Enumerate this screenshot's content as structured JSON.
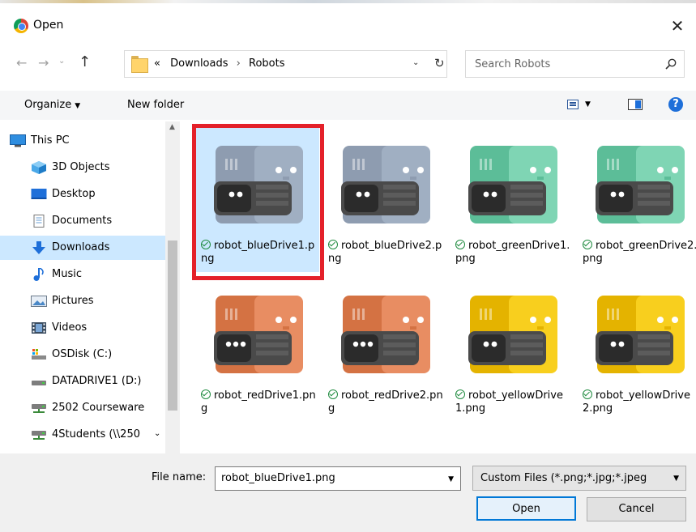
{
  "window": {
    "title": "Open",
    "close_symbol": "✕"
  },
  "nav": {
    "back": "←",
    "forward": "→",
    "history": "⌄",
    "up": "↑",
    "breadcrumbs": [
      "Downloads",
      "Robots"
    ],
    "breadcrumb_prefix": "«",
    "breadcrumb_sep": "›",
    "address_dropdown": "⌄",
    "refresh": "↻",
    "search_placeholder": "Search Robots"
  },
  "toolbar": {
    "organize": "Organize",
    "new_folder": "New folder",
    "help": "?"
  },
  "sidebar": {
    "items": [
      {
        "label": "This PC",
        "icon": "pc-icon"
      },
      {
        "label": "3D Objects",
        "icon": "3d-objects-icon"
      },
      {
        "label": "Desktop",
        "icon": "desktop-icon"
      },
      {
        "label": "Documents",
        "icon": "documents-icon"
      },
      {
        "label": "Downloads",
        "icon": "downloads-icon",
        "selected": true
      },
      {
        "label": "Music",
        "icon": "music-icon"
      },
      {
        "label": "Pictures",
        "icon": "pictures-icon"
      },
      {
        "label": "Videos",
        "icon": "videos-icon"
      },
      {
        "label": "OSDisk (C:)",
        "icon": "os-disk-icon"
      },
      {
        "label": "DATADRIVE1 (D:)",
        "icon": "drive-icon"
      },
      {
        "label": "2502 Courseware",
        "icon": "network-drive-icon"
      },
      {
        "label": "4Students (\\\\250",
        "icon": "network-drive-icon"
      }
    ]
  },
  "files": [
    {
      "name": "robot_blueDrive1.png",
      "color": "#a0afc2",
      "dark": "#8e9cb0",
      "selected": true
    },
    {
      "name": "robot_blueDrive2.png",
      "color": "#a0afc2",
      "dark": "#8e9cb0"
    },
    {
      "name": "robot_greenDrive1.png",
      "color": "#7fd5b4",
      "dark": "#5cbd98"
    },
    {
      "name": "robot_greenDrive2.png",
      "color": "#7fd5b4",
      "dark": "#5cbd98"
    },
    {
      "name": "robot_redDrive1.png",
      "color": "#e88d62",
      "dark": "#d47243"
    },
    {
      "name": "robot_redDrive2.png",
      "color": "#e88d62",
      "dark": "#d47243"
    },
    {
      "name": "robot_yellowDrive1.png",
      "color": "#f8cf1e",
      "dark": "#e4b300"
    },
    {
      "name": "robot_yellowDrive2.png",
      "color": "#f8cf1e",
      "dark": "#e4b300"
    }
  ],
  "footer": {
    "file_name_label": "File name:",
    "file_name_value": "robot_blueDrive1.png",
    "filter_value": "Custom Files (*.png;*.jpg;*.jpeg",
    "open_label": "Open",
    "cancel_label": "Cancel"
  },
  "colors": {
    "selection": "#cce8ff",
    "highlight_border": "#e4212a",
    "accent": "#0078d7"
  }
}
